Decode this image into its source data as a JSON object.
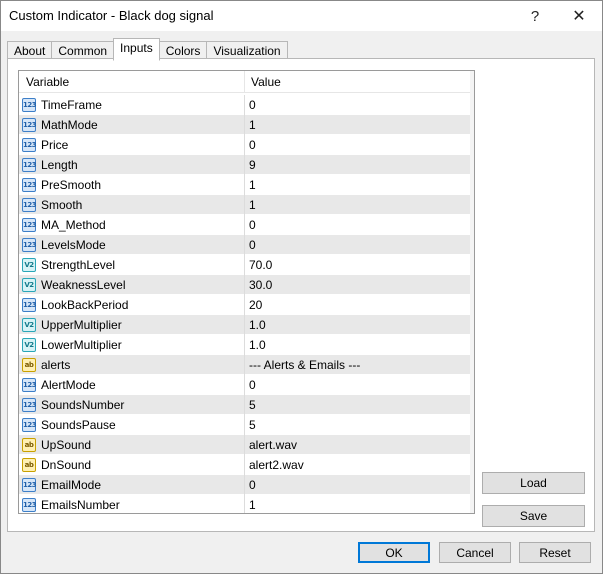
{
  "window": {
    "title": "Custom Indicator - Black dog signal",
    "help_glyph": "?",
    "close_glyph": "✕"
  },
  "tabs": [
    {
      "label": "About"
    },
    {
      "label": "Common"
    },
    {
      "label": "Inputs",
      "active": true
    },
    {
      "label": "Colors"
    },
    {
      "label": "Visualization"
    }
  ],
  "grid": {
    "headers": {
      "variable": "Variable",
      "value": "Value"
    },
    "rows": [
      {
        "icon": "integer-icon",
        "variable": "TimeFrame",
        "value": "0"
      },
      {
        "icon": "integer-icon",
        "variable": "MathMode",
        "value": "1"
      },
      {
        "icon": "integer-icon",
        "variable": "Price",
        "value": "0"
      },
      {
        "icon": "integer-icon",
        "variable": "Length",
        "value": "9"
      },
      {
        "icon": "integer-icon",
        "variable": "PreSmooth",
        "value": "1"
      },
      {
        "icon": "integer-icon",
        "variable": "Smooth",
        "value": "1"
      },
      {
        "icon": "integer-icon",
        "variable": "MA_Method",
        "value": "0"
      },
      {
        "icon": "integer-icon",
        "variable": "LevelsMode",
        "value": "0"
      },
      {
        "icon": "double-icon",
        "variable": "StrengthLevel",
        "value": "70.0"
      },
      {
        "icon": "double-icon",
        "variable": "WeaknessLevel",
        "value": "30.0"
      },
      {
        "icon": "integer-icon",
        "variable": "LookBackPeriod",
        "value": "20"
      },
      {
        "icon": "double-icon",
        "variable": "UpperMultiplier",
        "value": "1.0"
      },
      {
        "icon": "double-icon",
        "variable": "LowerMultiplier",
        "value": "1.0"
      },
      {
        "icon": "string-icon",
        "variable": "alerts",
        "value": "--- Alerts & Emails ---"
      },
      {
        "icon": "integer-icon",
        "variable": "AlertMode",
        "value": "0"
      },
      {
        "icon": "integer-icon",
        "variable": "SoundsNumber",
        "value": "5"
      },
      {
        "icon": "integer-icon",
        "variable": "SoundsPause",
        "value": "5"
      },
      {
        "icon": "string-icon",
        "variable": "UpSound",
        "value": "alert.wav"
      },
      {
        "icon": "string-icon",
        "variable": "DnSound",
        "value": "alert2.wav"
      },
      {
        "icon": "integer-icon",
        "variable": "EmailMode",
        "value": "0"
      },
      {
        "icon": "integer-icon",
        "variable": "EmailsNumber",
        "value": "1"
      }
    ]
  },
  "side_buttons": {
    "load": "Load",
    "save": "Save"
  },
  "footer": {
    "ok": "OK",
    "cancel": "Cancel",
    "reset": "Reset"
  },
  "icon_glyphs": {
    "integer-icon": "123",
    "double-icon": "V2",
    "string-icon": "ab"
  },
  "colors": {
    "accent": "#0078d7"
  }
}
